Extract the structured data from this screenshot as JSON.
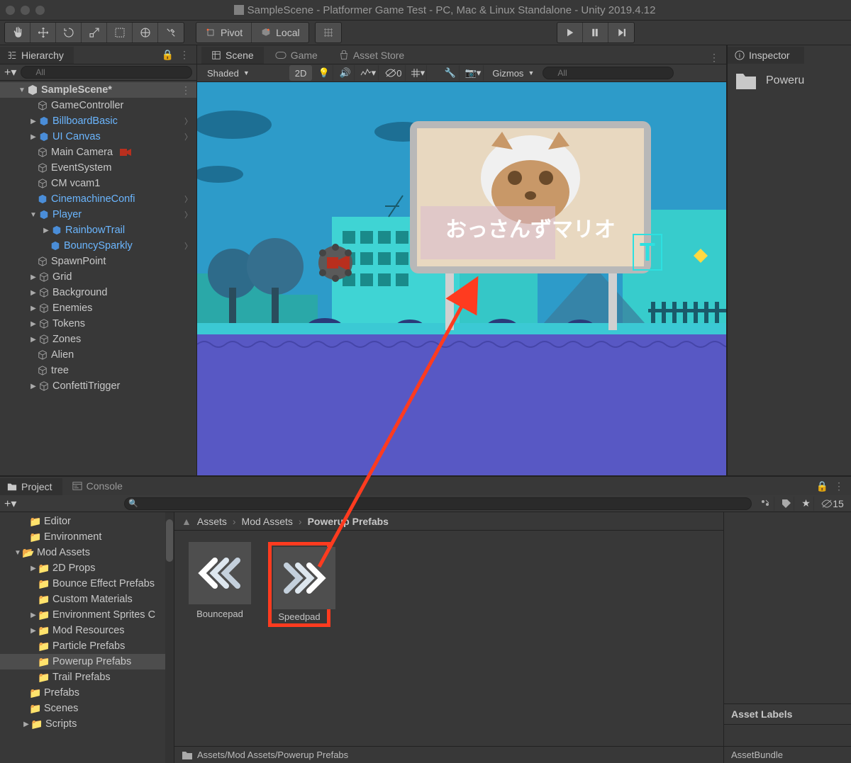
{
  "titlebar": {
    "title": "SampleScene - Platformer Game Test - PC, Mac & Linux Standalone - Unity 2019.4.12"
  },
  "toolbar": {
    "pivot": "Pivot",
    "local": "Local"
  },
  "hierarchy": {
    "tab": "Hierarchy",
    "search_placeholder": "All",
    "scene": "SampleScene*",
    "items": [
      "GameController",
      "BillboardBasic",
      "UI Canvas",
      "Main Camera",
      "EventSystem",
      "CM vcam1",
      "CinemachineConfi",
      "Player",
      "RainbowTrail",
      "BouncySparkly",
      "SpawnPoint",
      "Grid",
      "Background",
      "Enemies",
      "Tokens",
      "Zones",
      "Alien",
      "tree",
      "ConfettiTrigger"
    ]
  },
  "scene": {
    "tabs": [
      "Scene",
      "Game",
      "Asset Store"
    ],
    "shading_mode": "Shaded",
    "mode_2d": "2D",
    "gizmos": "Gizmos",
    "search_placeholder": "All",
    "billboard_text": "おっさんずマリオ",
    "collider_count": "0"
  },
  "inspector": {
    "tab": "Inspector",
    "selected": "Poweru"
  },
  "project": {
    "tab_project": "Project",
    "tab_console": "Console",
    "hidden_count": "15",
    "breadcrumb": [
      "Assets",
      "Mod Assets",
      "Powerup Prefabs"
    ],
    "tree": [
      "Editor",
      "Environment",
      "Mod Assets",
      "2D Props",
      "Bounce Effect Prefabs",
      "Custom Materials",
      "Environment Sprites C",
      "Mod Resources",
      "Particle Prefabs",
      "Powerup Prefabs",
      "Trail Prefabs",
      "Prefabs",
      "Scenes",
      "Scripts"
    ],
    "assets": [
      {
        "name": "Bouncepad",
        "direction": "left"
      },
      {
        "name": "Speedpad",
        "direction": "right"
      }
    ],
    "status_path": "Assets/Mod Assets/Powerup Prefabs",
    "asset_labels": "Asset Labels",
    "asset_bundle": "AssetBundle"
  }
}
